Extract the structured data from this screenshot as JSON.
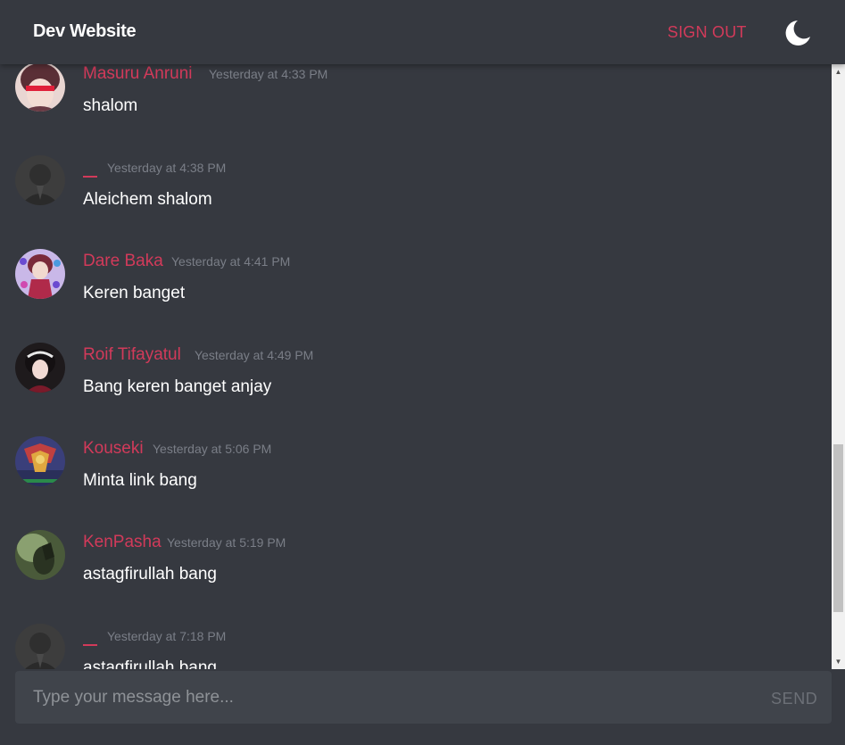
{
  "header": {
    "brand": "Dev Website",
    "signout_label": "SIGN OUT",
    "theme_icon": "moon-icon"
  },
  "colors": {
    "background": "#363940",
    "accent": "#d23a5a",
    "timestamp": "#7a7e87",
    "composer": "#40444b"
  },
  "messages": [
    {
      "username": "Masuru Anruni",
      "timestamp": "Yesterday at 4:33 PM",
      "text": "shalom"
    },
    {
      "username": "",
      "timestamp": "Yesterday at 4:38 PM",
      "text": "Aleichem shalom"
    },
    {
      "username": "Dare Baka",
      "timestamp": "Yesterday at 4:41 PM",
      "text": "Keren banget"
    },
    {
      "username": "Roif Tifayatul",
      "timestamp": "Yesterday at 4:49 PM",
      "text": "Bang keren banget anjay"
    },
    {
      "username": "Kouseki",
      "timestamp": "Yesterday at 5:06 PM",
      "text": "Minta link bang"
    },
    {
      "username": "KenPasha",
      "timestamp": "Yesterday at 5:19 PM",
      "text": "astagfirullah bang"
    },
    {
      "username": "",
      "timestamp": "Yesterday at 7:18 PM",
      "text": "astagfirullah bang"
    }
  ],
  "composer": {
    "placeholder": "Type your message here...",
    "value": "",
    "send_label": "SEND"
  }
}
